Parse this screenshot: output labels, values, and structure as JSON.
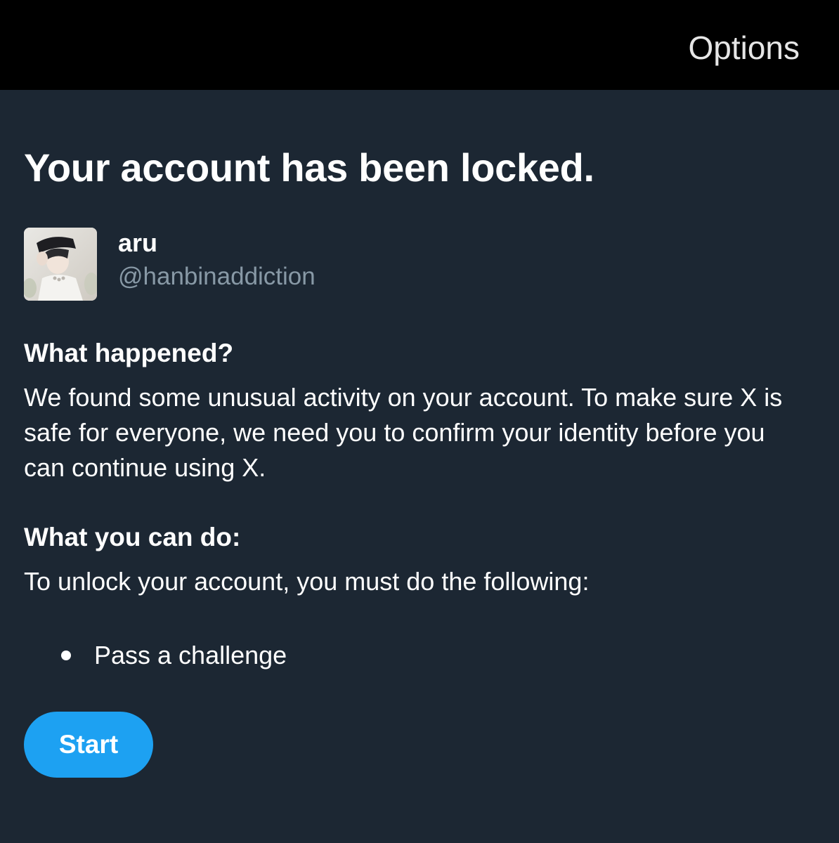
{
  "header": {
    "options_label": "Options"
  },
  "main": {
    "title": "Your account has been locked.",
    "account": {
      "display_name": "aru",
      "handle": "@hanbinaddiction"
    },
    "what_happened": {
      "heading": "What happened?",
      "body": "We found some unusual activity on your account. To make sure X is safe for everyone, we need you to confirm your identity before you can continue using X."
    },
    "what_you_can_do": {
      "heading": "What you can do:",
      "body": "To unlock your account, you must do the following:",
      "items": [
        "Pass a challenge"
      ]
    },
    "start_label": "Start"
  },
  "colors": {
    "background": "#1c2733",
    "header_background": "#000000",
    "accent": "#1da1f2",
    "secondary_text": "#8899a6"
  }
}
